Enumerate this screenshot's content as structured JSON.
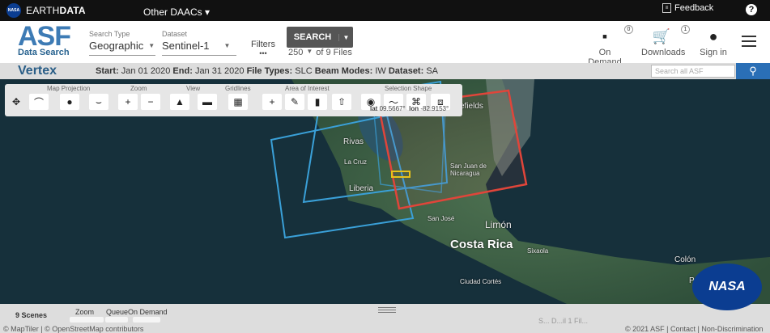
{
  "topbar": {
    "nasa_mini": "NASA",
    "earthdata_prefix": "EARTH",
    "earthdata_suffix": "DATA",
    "other_daacs": "Other DAACs",
    "feedback": "Feedback",
    "help": "?"
  },
  "header": {
    "logo_main": "ASF",
    "logo_sub": "Data Search",
    "search_type_label": "Search Type",
    "search_type_value": "Geographic",
    "dataset_label": "Dataset",
    "dataset_value": "Sentinel-1",
    "filters_label": "Filters",
    "filters_dots": "•••",
    "search_button": "SEARCH",
    "result_count": "250",
    "result_of": "of 9 Files",
    "on_demand": "On Demand",
    "on_demand_badge": "0",
    "downloads": "Downloads",
    "downloads_badge": "1",
    "sign_in": "Sign in"
  },
  "infobar": {
    "vertex": "Vertex",
    "start_label": "Start:",
    "start_value": "Jan 01 2020",
    "end_label": "End:",
    "end_value": "Jan 31 2020",
    "filetypes_label": "File Types:",
    "filetypes_value": "SLC",
    "beammodes_label": "Beam Modes:",
    "beammodes_value": "IW",
    "dataset_label": "Dataset:",
    "dataset_value": "SA",
    "search_placeholder": "Search all ASF"
  },
  "toolbar": {
    "map_projection": "Map Projection",
    "zoom": "Zoom",
    "view": "View",
    "gridlines": "Gridlines",
    "area_of_interest": "Area of Interest",
    "selection_shape": "Selection Shape",
    "lat_label": "lat",
    "lat_value": "09.5667°",
    "lon_label": "lon",
    "lon_value": "-82.9153°"
  },
  "map": {
    "places": [
      {
        "name": "efields"
      },
      {
        "name": "Rivas"
      },
      {
        "name": "La Cruz"
      },
      {
        "name": "San Juan de Nicaragua"
      },
      {
        "name": "Liberia"
      },
      {
        "name": "San José"
      },
      {
        "name": "Limón"
      },
      {
        "name": "Costa Rica"
      },
      {
        "name": "Sixaola"
      },
      {
        "name": "Ciudad Cortés"
      },
      {
        "name": "Colón"
      },
      {
        "name": "Pana"
      }
    ],
    "colors": {
      "footprint_blue": "#3aa0d8",
      "footprint_red": "#e0453a",
      "aoi_yellow": "#e7c21a"
    }
  },
  "bottom": {
    "scenes": "9 Scenes",
    "zoom": "Zoom",
    "queue": "Queue",
    "on_demand": "On Demand",
    "faded": "S... D...il 1 Fil...",
    "footer_left": "© MapTiler | © OpenStreetMap contributors",
    "footer_right": "© 2021 ASF | Contact | Non-Discrimination",
    "nasa": "NASA"
  }
}
